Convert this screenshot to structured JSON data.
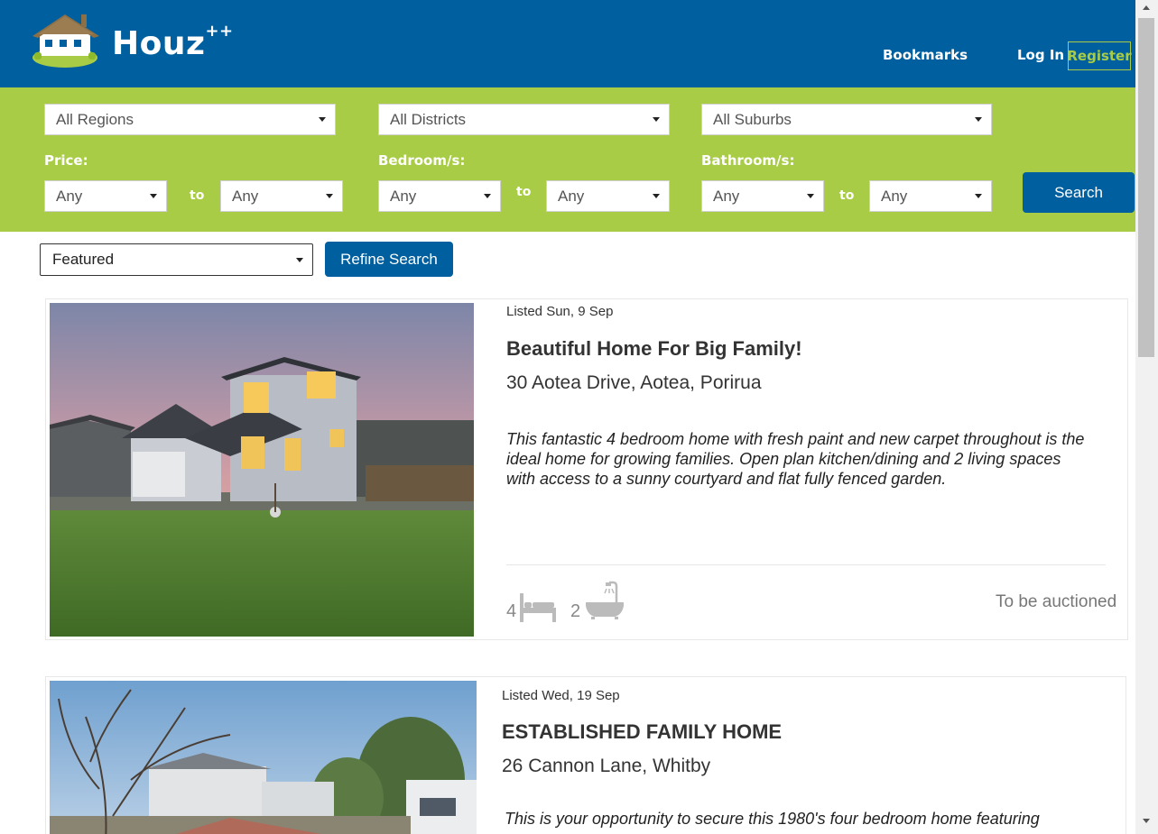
{
  "brand": {
    "name": "Houz",
    "suffix": "++"
  },
  "nav": {
    "bookmarks": "Bookmarks",
    "login": "Log In",
    "register": "Register"
  },
  "filters": {
    "region": "All Regions",
    "district": "All Districts",
    "suburb": "All Suburbs",
    "price_label": "Price:",
    "bedroom_label": "Bedroom/s:",
    "bathroom_label": "Bathroom/s:",
    "to": "to",
    "price_min": "Any",
    "price_max": "Any",
    "bed_min": "Any",
    "bed_max": "Any",
    "bath_min": "Any",
    "bath_max": "Any",
    "search": "Search"
  },
  "sort": {
    "selected": "Featured",
    "refine": "Refine Search"
  },
  "listings": [
    {
      "listed": "Listed Sun, 9 Sep",
      "title": "Beautiful Home For Big Family!",
      "address": "30 Aotea Drive, Aotea, Porirua",
      "description": "This fantastic 4 bedroom home with fresh paint and new carpet throughout is the ideal home for growing families. Open plan kitchen/dining and 2 living spaces with access to a sunny courtyard and flat fully fenced garden.",
      "bedrooms": "4",
      "bathrooms": "2",
      "sale_method": "To be auctioned"
    },
    {
      "listed": "Listed Wed, 19 Sep",
      "title": "ESTABLISHED FAMILY HOME",
      "address": "26 Cannon Lane, Whitby",
      "description": "This is your opportunity to secure this 1980's four bedroom home featuring"
    }
  ],
  "colors": {
    "header": "#005f9e",
    "accent": "#a8cc46",
    "button": "#005f9e"
  }
}
